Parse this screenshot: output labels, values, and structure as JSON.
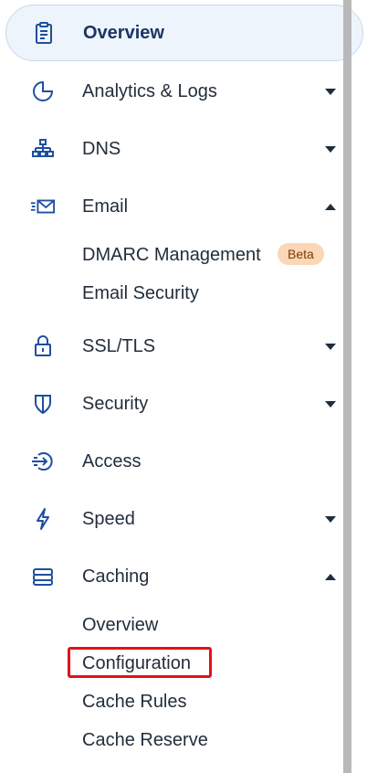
{
  "nav": {
    "overview": {
      "label": "Overview",
      "icon": "clipboard-icon"
    },
    "analytics": {
      "label": "Analytics & Logs",
      "icon": "pie-chart-icon"
    },
    "dns": {
      "label": "DNS",
      "icon": "network-tree-icon"
    },
    "email": {
      "label": "Email",
      "icon": "email-icon",
      "sub": {
        "dmarc": "DMARC Management",
        "dmarc_badge": "Beta",
        "security": "Email Security"
      }
    },
    "ssl": {
      "label": "SSL/TLS",
      "icon": "lock-icon"
    },
    "security": {
      "label": "Security",
      "icon": "shield-icon"
    },
    "access": {
      "label": "Access",
      "icon": "access-icon"
    },
    "speed": {
      "label": "Speed",
      "icon": "lightning-icon"
    },
    "caching": {
      "label": "Caching",
      "icon": "server-stack-icon",
      "sub": {
        "overview": "Overview",
        "configuration": "Configuration",
        "cache_rules": "Cache Rules",
        "cache_reserve": "Cache Reserve"
      }
    }
  },
  "colors": {
    "icon": "#1d4fa0",
    "highlight": "#e3111b",
    "badge_bg": "#fbd7b6",
    "active_bg": "#eef4fb"
  }
}
